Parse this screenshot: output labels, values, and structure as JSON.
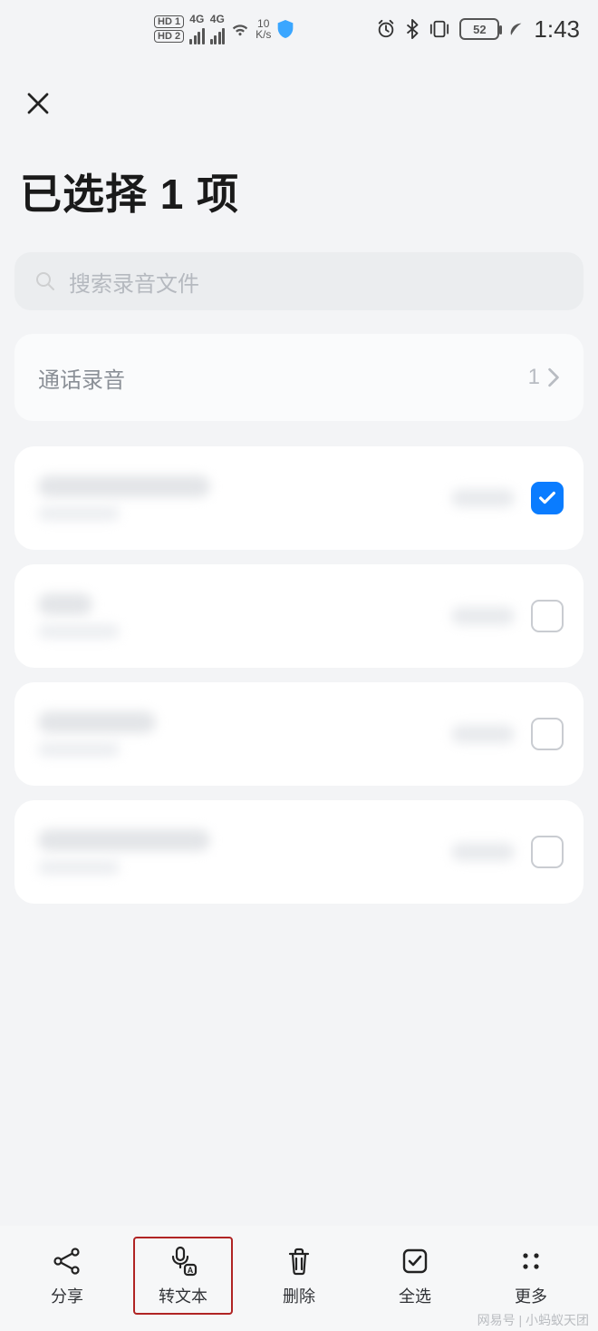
{
  "status": {
    "hd1": "HD 1",
    "hd2": "HD 2",
    "net1": "4G",
    "net2": "4G",
    "speed_top": "10",
    "speed_bot": "K/s",
    "battery": "52",
    "time": "1:43"
  },
  "header": {
    "title": "已选择 1 项"
  },
  "search": {
    "placeholder": "搜索录音文件"
  },
  "category": {
    "label": "通话录音",
    "count": "1"
  },
  "list": {
    "items": [
      {
        "selected": true
      },
      {
        "selected": false
      },
      {
        "selected": false
      },
      {
        "selected": false
      }
    ]
  },
  "actions": {
    "share": "分享",
    "transcribe": "转文本",
    "delete": "删除",
    "select_all": "全选",
    "more": "更多"
  },
  "watermark": "网易号 | 小蚂蚁天团"
}
